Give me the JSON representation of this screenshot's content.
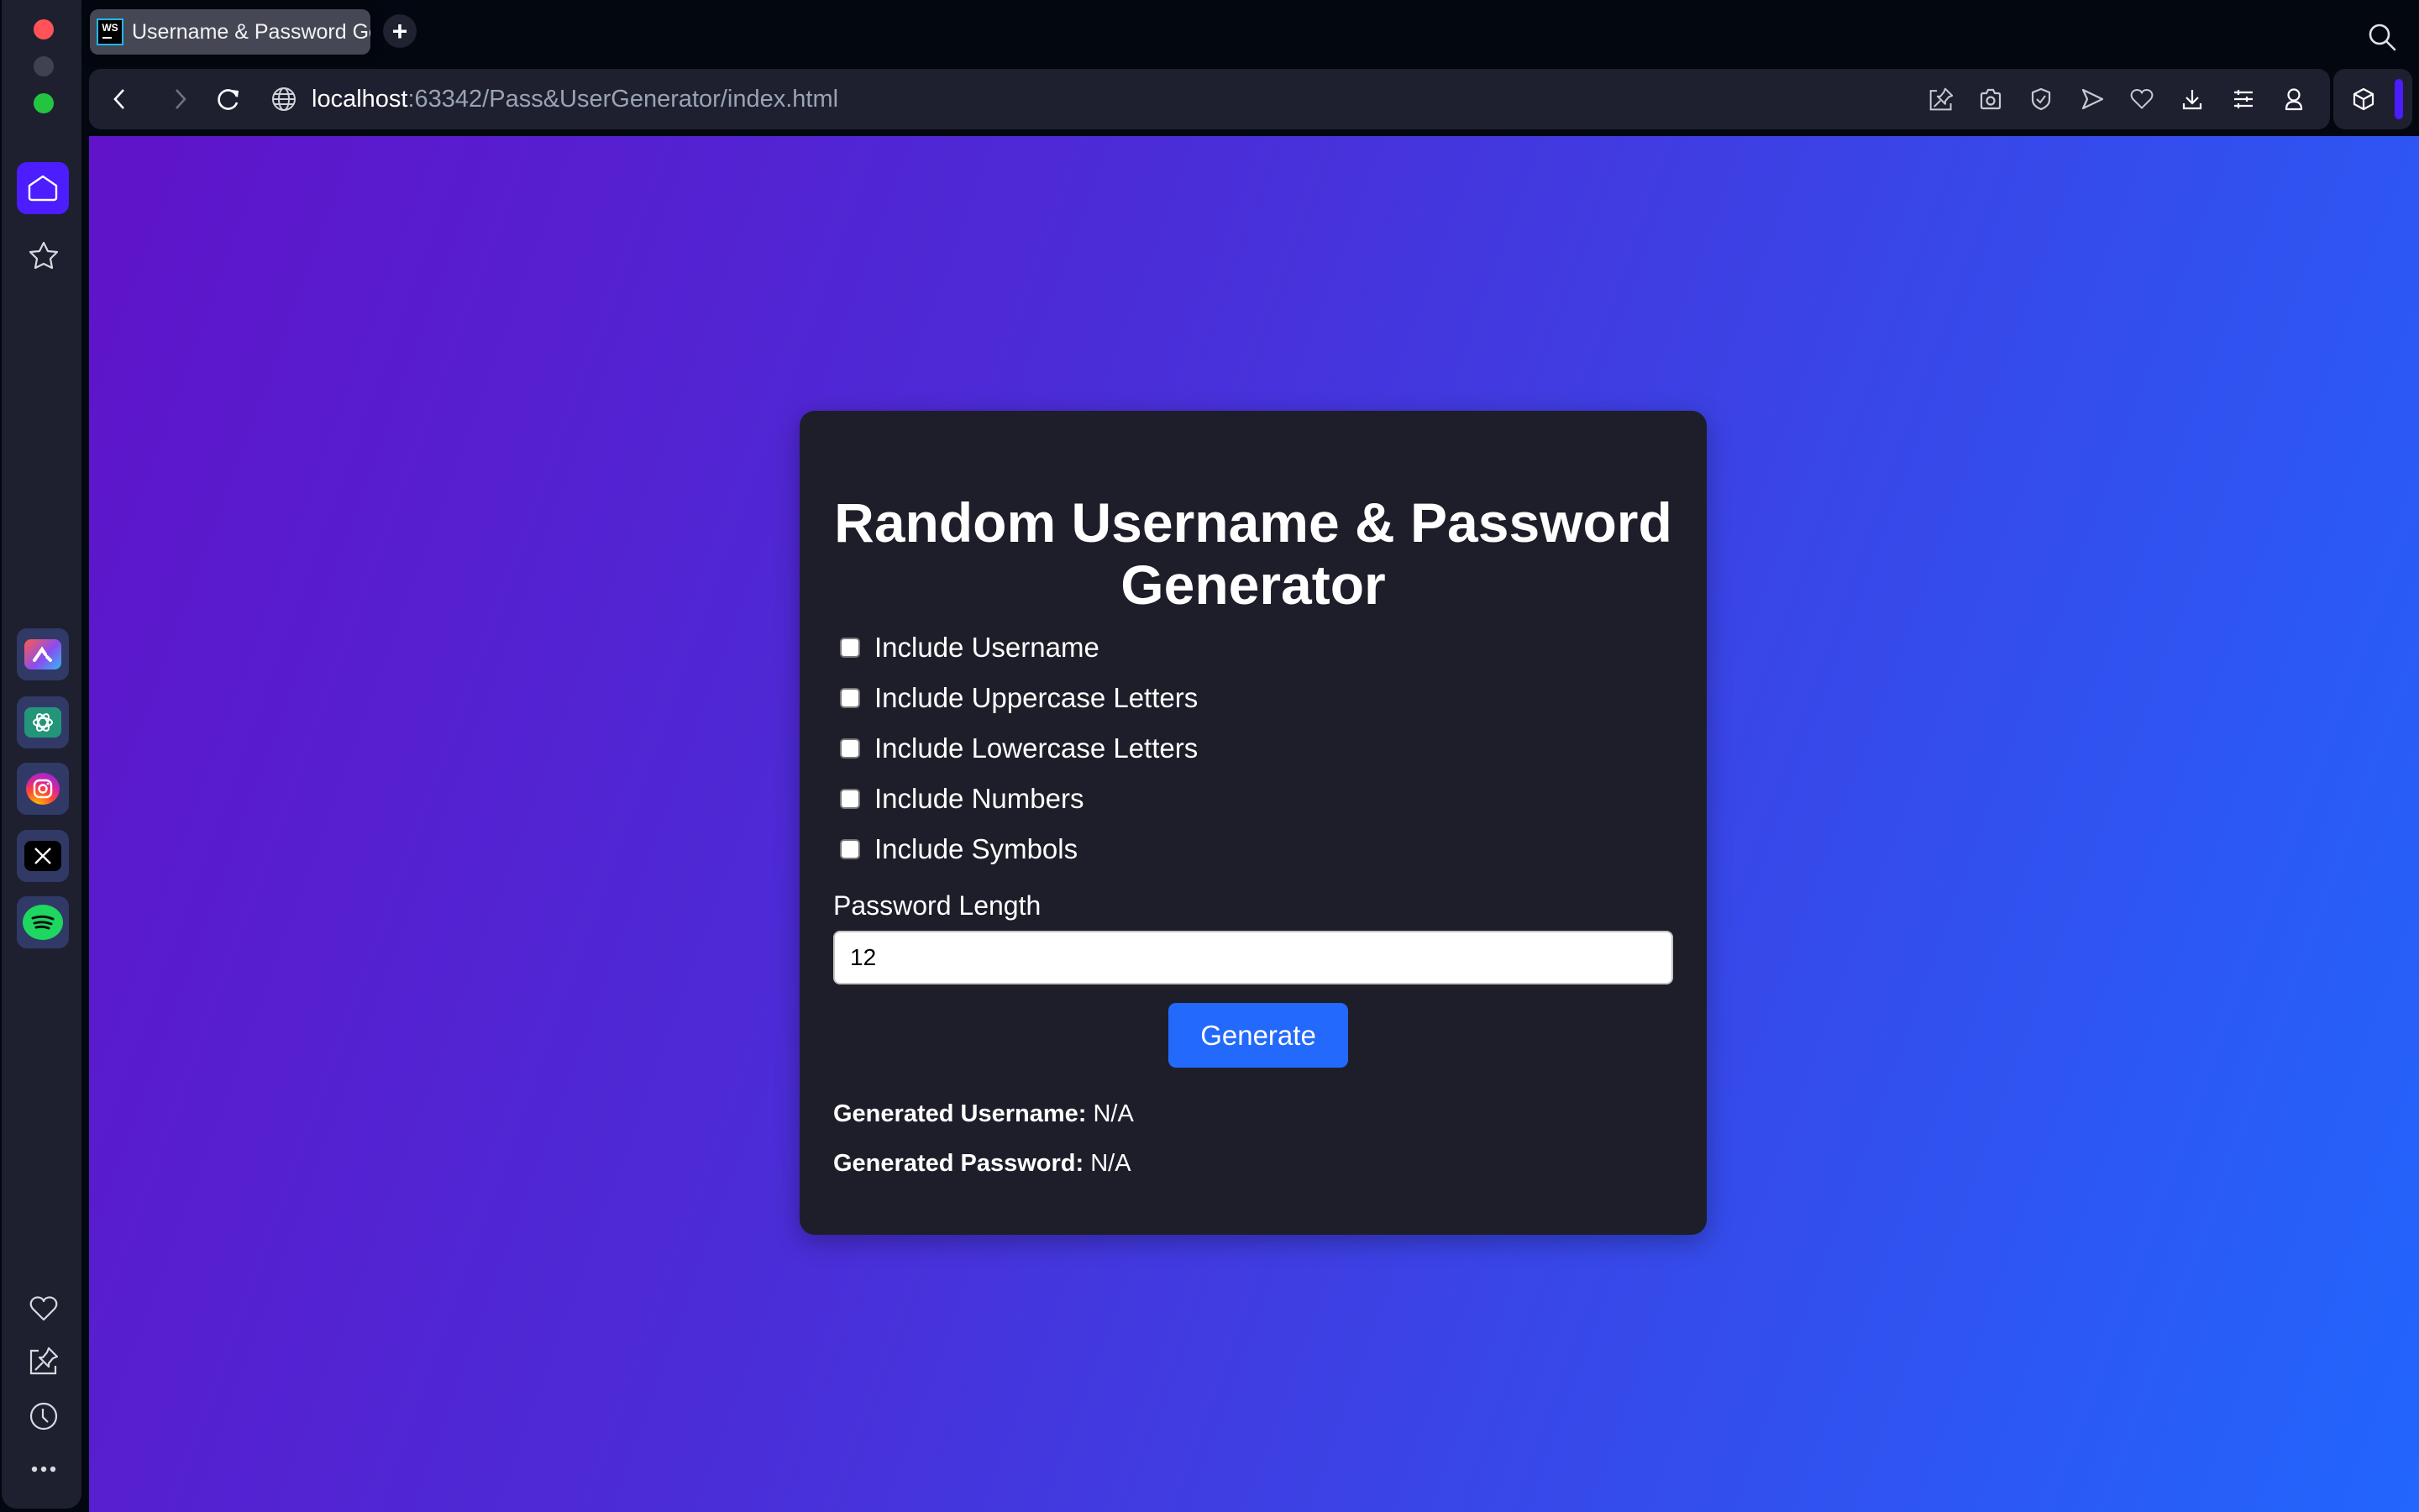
{
  "browser": {
    "tab": {
      "title": "Username & Password Generator",
      "favicon": "webstorm-icon"
    },
    "new_tab_label": "+",
    "url": {
      "host": "localhost",
      "rest": ":63342/Pass&UserGenerator/index.html"
    },
    "toolbar_icons": [
      "pin-note-icon",
      "camera-icon",
      "shield-check-icon",
      "send-icon",
      "heart-icon",
      "download-icon",
      "sliders-icon",
      "profile-icon"
    ],
    "extension_icon": "cube-icon",
    "accent_color": "#4b1dff"
  },
  "sidebar": {
    "top_items": [
      {
        "name": "home",
        "active": true
      },
      {
        "name": "bookmarks",
        "active": false
      }
    ],
    "apps": [
      "aria",
      "chatgpt",
      "instagram",
      "x",
      "spotify"
    ],
    "bottom_items": [
      "heart",
      "pinboard",
      "history",
      "more"
    ]
  },
  "page": {
    "title": "Random Username & Password Generator",
    "options": [
      {
        "label": "Include Username",
        "checked": false
      },
      {
        "label": "Include Uppercase Letters",
        "checked": false
      },
      {
        "label": "Include Lowercase Letters",
        "checked": false
      },
      {
        "label": "Include Numbers",
        "checked": false
      },
      {
        "label": "Include Symbols",
        "checked": false
      }
    ],
    "length_label": "Password Length",
    "length_value": "12",
    "generate_label": "Generate",
    "username_label": "Generated Username:",
    "username_value": "N/A",
    "password_label": "Generated Password:",
    "password_value": "N/A",
    "colors": {
      "gradient_start": "#6013c9",
      "gradient_end": "#2266fd",
      "card_bg": "#1e1e2a",
      "button": "#2269fc"
    }
  }
}
